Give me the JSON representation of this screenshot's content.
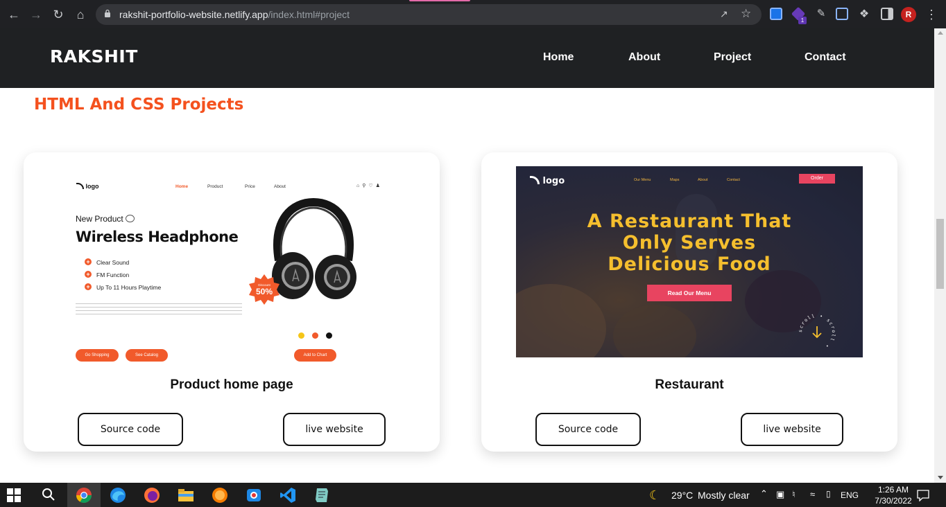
{
  "browser": {
    "url_host": "rakshit-portfolio-website.netlify.app",
    "url_path": "/index.html#project",
    "profile_initial": "R",
    "extension_badge": "1"
  },
  "site": {
    "brand": "RAKSHIT",
    "nav": [
      "Home",
      "About",
      "Project",
      "Contact"
    ],
    "section_title": "HTML And CSS Projects"
  },
  "projects": [
    {
      "title": "Product home page",
      "source_label": "Source code",
      "live_label": "live website",
      "preview": {
        "logo": "logo",
        "menu": [
          "Home",
          "Product",
          "Price",
          "About"
        ],
        "eyebrow": "New Product",
        "headline": "Wireless Headphone",
        "features": [
          "Clear Sound",
          "FM Function",
          "Up To 11 Hours Playtime"
        ],
        "discount_label": "Discount",
        "discount": "50%",
        "buttons": [
          "Go Shopping",
          "See Catalog"
        ],
        "cart_button": "Add to Chart"
      }
    },
    {
      "title": "Restaurant",
      "source_label": "Source code",
      "live_label": "live website",
      "preview": {
        "logo": "logo",
        "menu": [
          "Our Menu",
          "Maps",
          "About",
          "Contact"
        ],
        "order": "Order",
        "headline_lines": [
          "A Restaurant That",
          "Only Serves",
          "Delicious Food"
        ],
        "cta": "Read Our Menu",
        "scroll_text": "scroll • scroll •"
      }
    }
  ],
  "taskbar": {
    "weather_temp": "29°C",
    "weather_text": "Mostly clear",
    "language": "ENG",
    "time": "1:26 AM",
    "date": "7/30/2022"
  },
  "colors": {
    "accent": "#f4511e",
    "header_bg": "#1f2123",
    "restaurant_gold": "#f5bf2e",
    "restaurant_pink": "#e84460"
  }
}
